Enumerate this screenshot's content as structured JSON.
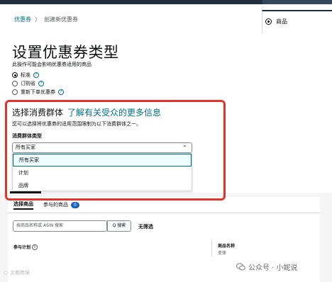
{
  "breadcrumb": {
    "root": "优惠券",
    "separator": "〉",
    "current": "创建新优惠券"
  },
  "side_panel": {
    "label": "商品"
  },
  "page": {
    "title": "设置优惠券类型",
    "subtitle": "此操作可能会影响优惠券适用的商品",
    "coupon_types": [
      {
        "label": "标准",
        "selected": true
      },
      {
        "label": "订购省",
        "selected": false
      },
      {
        "label": "重新下单优惠券",
        "selected": false
      }
    ]
  },
  "audience": {
    "title": "选择消费群体",
    "link": "了解有关受众的更多信息",
    "description": "您可以选择将优惠券的适用范围限制为以下消费群体之一。",
    "field_label": "消费群体类型",
    "selected_value": "所有买家",
    "options": [
      "所有买家",
      "计划",
      "品牌"
    ]
  },
  "products": {
    "tabs": [
      {
        "label": "选择商品",
        "active": true
      },
      {
        "label": "参与的商品",
        "count": "0",
        "active": false
      }
    ],
    "search_placeholder": "按商品名称或 ASIN 搜索",
    "search_button": "Q 搜索",
    "no_filter": "无筛选",
    "col_left": "参与计划",
    "col_right_title": "商品名称",
    "col_right_sub": "变体"
  },
  "watermarks": {
    "left": "文都跨境",
    "right": "公众号 · 小妮说"
  },
  "colors": {
    "link": "#007185",
    "highlight": "#e0352b",
    "badge": "#1565c0"
  }
}
